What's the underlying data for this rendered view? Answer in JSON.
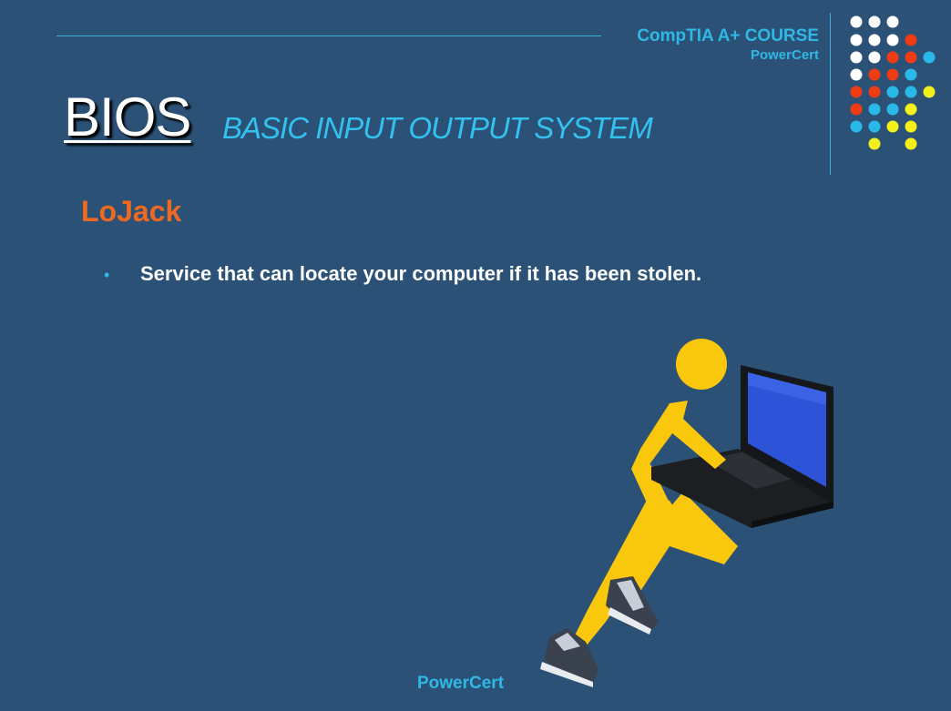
{
  "header": {
    "course": "CompTIA A+ COURSE",
    "brand": "PowerCert"
  },
  "title": {
    "main": "BIOS",
    "subtitle": "BASIC INPUT OUTPUT SYSTEM"
  },
  "section": {
    "heading": "LoJack",
    "bullets": [
      {
        "glyph": "•",
        "text": "Service that can locate your computer if it has been stolen."
      }
    ]
  },
  "illustration": {
    "icon": "running-thief-with-laptop-illustration"
  },
  "footer": {
    "brand": "PowerCert"
  },
  "colors": {
    "background": "#2b5276",
    "accent_blue": "#2fb8e6",
    "heading_orange": "#ee6a20",
    "dot_white": "#ffffff",
    "dot_red": "#f03c14",
    "dot_blue": "#2ab8e8",
    "dot_yellow": "#f5f01c",
    "figure_yellow": "#f9c70c"
  }
}
